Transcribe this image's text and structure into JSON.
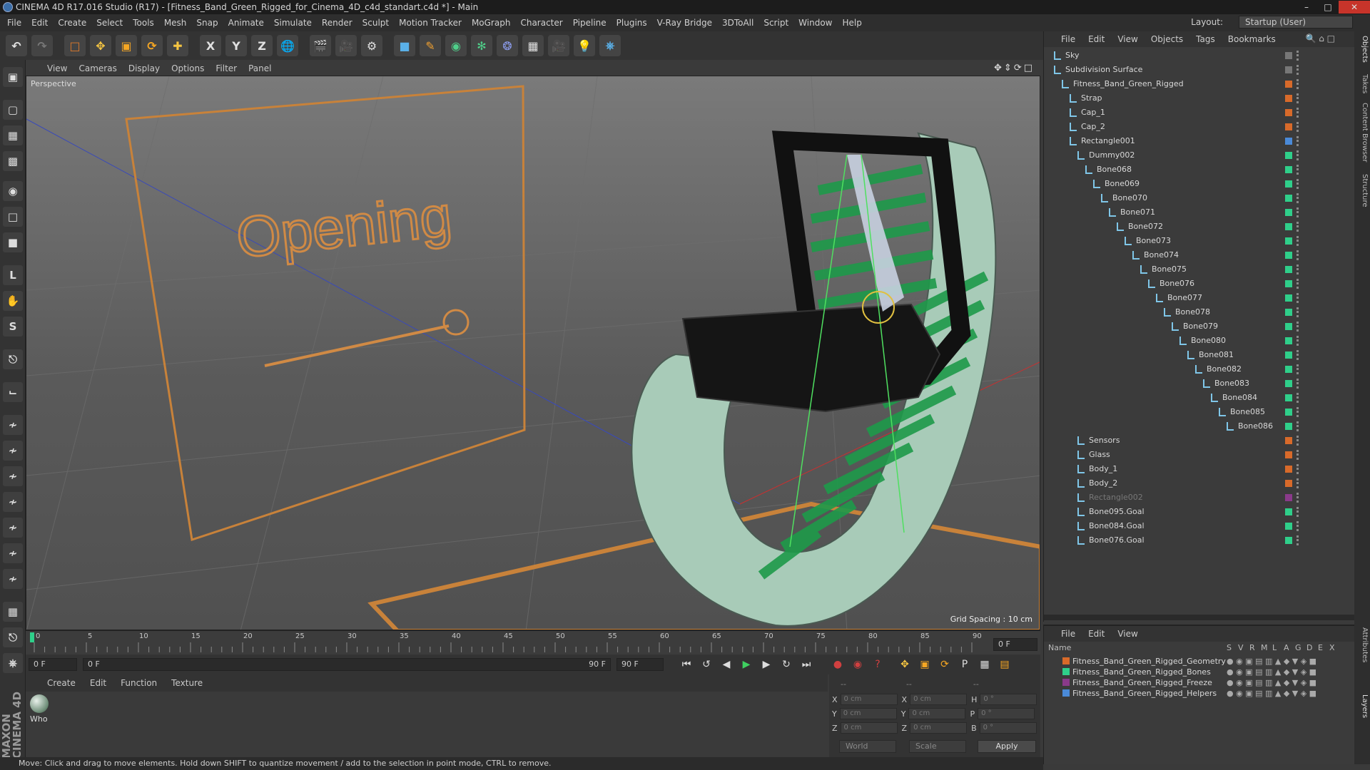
{
  "window": {
    "title": "CINEMA 4D R17.016 Studio (R17) - [Fitness_Band_Green_Rigged_for_Cinema_4D_c4d_standart.c4d *] - Main"
  },
  "menubar": {
    "items": [
      "File",
      "Edit",
      "Create",
      "Select",
      "Tools",
      "Mesh",
      "Snap",
      "Animate",
      "Simulate",
      "Render",
      "Sculpt",
      "Motion Tracker",
      "MoGraph",
      "Character",
      "Pipeline",
      "Plugins",
      "V-Ray Bridge",
      "3DToAll",
      "Script",
      "Window",
      "Help"
    ],
    "layout_label": "Layout:",
    "layout_value": "Startup (User)"
  },
  "viewport": {
    "menu": [
      "View",
      "Cameras",
      "Display",
      "Options",
      "Filter",
      "Panel"
    ],
    "label": "Perspective",
    "grid_spacing": "Grid Spacing : 10 cm",
    "scene_text": "Opening"
  },
  "timeline": {
    "ticks": [
      "0",
      "5",
      "10",
      "15",
      "20",
      "25",
      "30",
      "35",
      "40",
      "45",
      "50",
      "55",
      "60",
      "65",
      "70",
      "75",
      "80",
      "85",
      "90"
    ],
    "frame_end_display": "0 F",
    "start_frame": "0 F",
    "range_start": "0 F",
    "range_end": "90 F",
    "end_frame": "90 F"
  },
  "material_manager": {
    "menu": [
      "Create",
      "Edit",
      "Function",
      "Texture"
    ],
    "material_name": "Who"
  },
  "coordinates": {
    "pos_labels": [
      "X",
      "Y",
      "Z"
    ],
    "size_labels": [
      "X",
      "Y",
      "Z"
    ],
    "rot_labels": [
      "H",
      "P",
      "B"
    ],
    "pos_values": [
      "0 cm",
      "0 cm",
      "0 cm"
    ],
    "size_values": [
      "0 cm",
      "0 cm",
      "0 cm"
    ],
    "rot_values": [
      "0 °",
      "0 °",
      "0 °"
    ],
    "mode_world": "World",
    "mode_scale": "Scale",
    "apply": "Apply",
    "header_dashes": [
      "--",
      "--",
      "--"
    ]
  },
  "object_manager": {
    "menu": [
      "File",
      "Edit",
      "View",
      "Objects",
      "Tags",
      "Bookmarks"
    ],
    "objects": [
      {
        "name": "Sky",
        "indent": 0,
        "color": "#777777",
        "dim": false
      },
      {
        "name": "Subdivision Surface",
        "indent": 0,
        "color": "#777777",
        "dim": false
      },
      {
        "name": "Fitness_Band_Green_Rigged",
        "indent": 1,
        "color": "#d86a2a",
        "dim": false
      },
      {
        "name": "Strap",
        "indent": 2,
        "color": "#d86a2a",
        "dim": false
      },
      {
        "name": "Cap_1",
        "indent": 2,
        "color": "#d86a2a",
        "dim": false
      },
      {
        "name": "Cap_2",
        "indent": 2,
        "color": "#d86a2a",
        "dim": false
      },
      {
        "name": "Rectangle001",
        "indent": 2,
        "color": "#4a8ad8",
        "dim": false
      },
      {
        "name": "Dummy002",
        "indent": 3,
        "color": "#2fcf8a",
        "dim": false
      },
      {
        "name": "Bone068",
        "indent": 4,
        "color": "#2fcf8a",
        "dim": false
      },
      {
        "name": "Bone069",
        "indent": 5,
        "color": "#2fcf8a",
        "dim": false
      },
      {
        "name": "Bone070",
        "indent": 6,
        "color": "#2fcf8a",
        "dim": false
      },
      {
        "name": "Bone071",
        "indent": 7,
        "color": "#2fcf8a",
        "dim": false
      },
      {
        "name": "Bone072",
        "indent": 8,
        "color": "#2fcf8a",
        "dim": false
      },
      {
        "name": "Bone073",
        "indent": 9,
        "color": "#2fcf8a",
        "dim": false
      },
      {
        "name": "Bone074",
        "indent": 10,
        "color": "#2fcf8a",
        "dim": false
      },
      {
        "name": "Bone075",
        "indent": 11,
        "color": "#2fcf8a",
        "dim": false
      },
      {
        "name": "Bone076",
        "indent": 12,
        "color": "#2fcf8a",
        "dim": false
      },
      {
        "name": "Bone077",
        "indent": 13,
        "color": "#2fcf8a",
        "dim": false
      },
      {
        "name": "Bone078",
        "indent": 14,
        "color": "#2fcf8a",
        "dim": false
      },
      {
        "name": "Bone079",
        "indent": 15,
        "color": "#2fcf8a",
        "dim": false
      },
      {
        "name": "Bone080",
        "indent": 16,
        "color": "#2fcf8a",
        "dim": false
      },
      {
        "name": "Bone081",
        "indent": 17,
        "color": "#2fcf8a",
        "dim": false
      },
      {
        "name": "Bone082",
        "indent": 18,
        "color": "#2fcf8a",
        "dim": false
      },
      {
        "name": "Bone083",
        "indent": 19,
        "color": "#2fcf8a",
        "dim": false
      },
      {
        "name": "Bone084",
        "indent": 20,
        "color": "#2fcf8a",
        "dim": false
      },
      {
        "name": "Bone085",
        "indent": 21,
        "color": "#2fcf8a",
        "dim": false
      },
      {
        "name": "Bone086",
        "indent": 22,
        "color": "#2fcf8a",
        "dim": false
      },
      {
        "name": "Sensors",
        "indent": 3,
        "color": "#d86a2a",
        "dim": false
      },
      {
        "name": "Glass",
        "indent": 3,
        "color": "#d86a2a",
        "dim": false
      },
      {
        "name": "Body_1",
        "indent": 3,
        "color": "#d86a2a",
        "dim": false
      },
      {
        "name": "Body_2",
        "indent": 3,
        "color": "#d86a2a",
        "dim": false
      },
      {
        "name": "Rectangle002",
        "indent": 3,
        "color": "#8a3a8a",
        "dim": true
      },
      {
        "name": "Bone095.Goal",
        "indent": 3,
        "color": "#2fcf8a",
        "dim": false
      },
      {
        "name": "Bone084.Goal",
        "indent": 3,
        "color": "#2fcf8a",
        "dim": false
      },
      {
        "name": "Bone076.Goal",
        "indent": 3,
        "color": "#2fcf8a",
        "dim": false
      }
    ]
  },
  "layer_manager": {
    "menu": [
      "File",
      "Edit",
      "View"
    ],
    "header_name": "Name",
    "header_flags": [
      "S",
      "V",
      "R",
      "M",
      "L",
      "A",
      "G",
      "D",
      "E",
      "X"
    ],
    "layers": [
      {
        "name": "Fitness_Band_Green_Rigged_Geometry",
        "color": "#d86a2a"
      },
      {
        "name": "Fitness_Band_Green_Rigged_Bones",
        "color": "#2fcf8a"
      },
      {
        "name": "Fitness_Band_Green_Rigged_Freeze",
        "color": "#8a3a8a"
      },
      {
        "name": "Fitness_Band_Green_Rigged_Helpers",
        "color": "#4a8ad8"
      }
    ]
  },
  "side_tabs": [
    "Objects",
    "Takes",
    "Content Browser",
    "Structure",
    "Attributes",
    "Layers"
  ],
  "status": {
    "text": "Move: Click and drag to move elements. Hold down SHIFT to quantize movement / add to the selection in point mode, CTRL to remove."
  },
  "branding": {
    "maxon": "MAXON",
    "cinema": "CINEMA 4D"
  }
}
